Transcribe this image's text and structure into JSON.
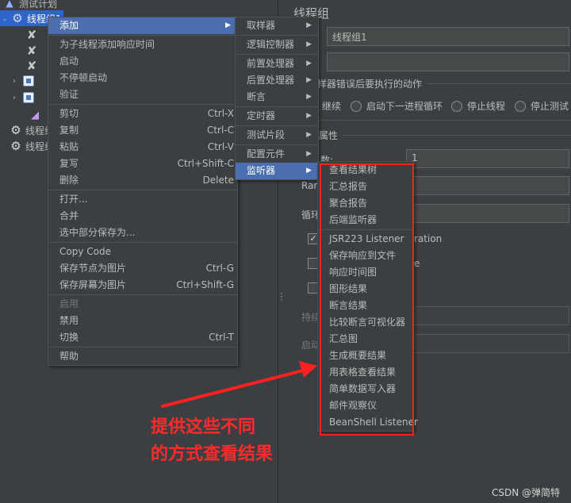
{
  "tree": {
    "root_label": "测试计划",
    "selected_label": "线程组1",
    "items": [
      {
        "label": "线程组",
        "icon": "gear-icon"
      },
      {
        "label": "线程组",
        "icon": "gear-icon"
      }
    ]
  },
  "right_panel": {
    "title": "线程组",
    "name_value": "线程组1",
    "comment_value": "",
    "error_action_label": "样器错误后要执行的动作",
    "radio_options": [
      "继续",
      "启动下一进程循环",
      "停止线程",
      "停止测试"
    ],
    "properties_label": "属性",
    "threads_label": "数:",
    "threads_value": "1",
    "ramp_label": "Ran",
    "loop_label": "循环",
    "duration_fragment": "ration",
    "fragment_e": "e",
    "duration_label": "持续",
    "delay_label": "启动"
  },
  "context_menu": {
    "items": [
      {
        "label": "添加",
        "shortcut": "",
        "submenu": true,
        "state": "active"
      },
      {
        "label": "为子线程添加响应时间",
        "shortcut": "",
        "submenu": false,
        "state": "normal"
      },
      {
        "label": "启动",
        "shortcut": "",
        "submenu": false,
        "state": "normal"
      },
      {
        "label": "不停顿启动",
        "shortcut": "",
        "submenu": false,
        "state": "normal"
      },
      {
        "label": "验证",
        "shortcut": "",
        "submenu": false,
        "state": "normal"
      },
      {
        "label": "剪切",
        "shortcut": "Ctrl-X",
        "submenu": false,
        "state": "normal"
      },
      {
        "label": "复制",
        "shortcut": "Ctrl-C",
        "submenu": false,
        "state": "normal"
      },
      {
        "label": "粘贴",
        "shortcut": "Ctrl-V",
        "submenu": false,
        "state": "normal"
      },
      {
        "label": "复写",
        "shortcut": "Ctrl+Shift-C",
        "submenu": false,
        "state": "normal"
      },
      {
        "label": "删除",
        "shortcut": "Delete",
        "submenu": false,
        "state": "normal"
      },
      {
        "label": "打开...",
        "shortcut": "",
        "submenu": false,
        "state": "normal"
      },
      {
        "label": "合并",
        "shortcut": "",
        "submenu": false,
        "state": "normal"
      },
      {
        "label": "选中部分保存为...",
        "shortcut": "",
        "submenu": false,
        "state": "normal"
      },
      {
        "label": "Copy Code",
        "shortcut": "",
        "submenu": false,
        "state": "normal"
      },
      {
        "label": "保存节点为图片",
        "shortcut": "Ctrl-G",
        "submenu": false,
        "state": "normal"
      },
      {
        "label": "保存屏幕为图片",
        "shortcut": "Ctrl+Shift-G",
        "submenu": false,
        "state": "normal"
      },
      {
        "label": "启用",
        "shortcut": "",
        "submenu": false,
        "state": "disabled"
      },
      {
        "label": "禁用",
        "shortcut": "",
        "submenu": false,
        "state": "normal"
      },
      {
        "label": "切换",
        "shortcut": "Ctrl-T",
        "submenu": false,
        "state": "normal"
      },
      {
        "label": "帮助",
        "shortcut": "",
        "submenu": false,
        "state": "normal"
      }
    ]
  },
  "add_submenu": {
    "items": [
      {
        "label": "取样器",
        "state": "normal"
      },
      {
        "label": "逻辑控制器",
        "state": "normal"
      },
      {
        "label": "前置处理器",
        "state": "normal"
      },
      {
        "label": "后置处理器",
        "state": "normal"
      },
      {
        "label": "断言",
        "state": "normal"
      },
      {
        "label": "定时器",
        "state": "normal"
      },
      {
        "label": "测试片段",
        "state": "normal"
      },
      {
        "label": "配置元件",
        "state": "normal"
      },
      {
        "label": "监听器",
        "state": "active"
      }
    ]
  },
  "listener_submenu": {
    "items": [
      "查看结果树",
      "汇总报告",
      "聚合报告",
      "后端监听器",
      "JSR223 Listener",
      "保存响应到文件",
      "响应时间图",
      "图形结果",
      "断言结果",
      "比较断言可视化器",
      "汇总图",
      "生成概要结果",
      "用表格查看结果",
      "简单数据写入器",
      "邮件观察仪",
      "BeanShell Listener"
    ]
  },
  "annotation": {
    "line1": "提供这些不同",
    "line2": "的方式查看结果",
    "color": "#ff2020"
  },
  "watermark": "CSDN @弹简特",
  "colors": {
    "background": "#3c3f41",
    "menu_highlight": "#4b6eaf",
    "tree_selection": "#2f65ca",
    "annotation_red": "#ff2020"
  }
}
